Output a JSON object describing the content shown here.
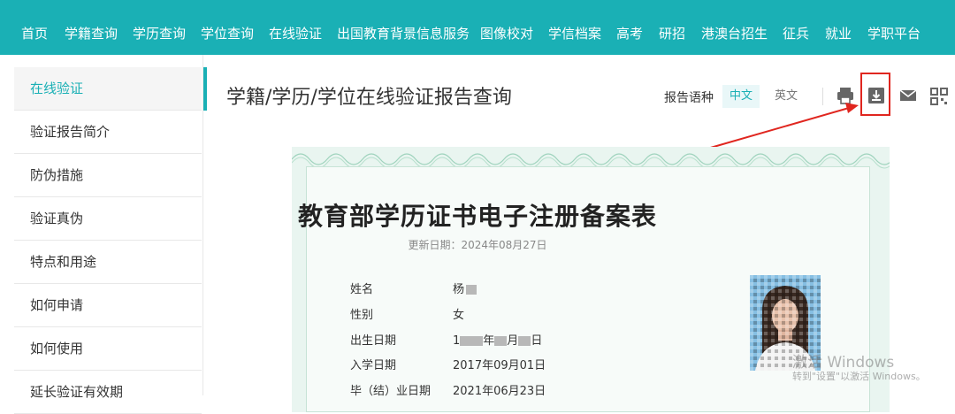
{
  "nav": {
    "items": [
      "首页",
      "学籍查询",
      "学历查询",
      "学位查询",
      "在线验证",
      "出国教育背景信息服务",
      "图像校对",
      "学信档案",
      "高考",
      "研招",
      "港澳台招生",
      "征兵",
      "就业",
      "学职平台"
    ]
  },
  "sidebar": {
    "items": [
      "在线验证",
      "验证报告简介",
      "防伪措施",
      "验证真伪",
      "特点和用途",
      "如何申请",
      "如何使用",
      "延长验证有效期"
    ]
  },
  "main": {
    "title": "学籍/学历/学位在线验证报告查询"
  },
  "report_lang": {
    "label": "报告语种",
    "zh": "中文",
    "en": "英文"
  },
  "toolbar": {
    "icons": [
      "printer-icon",
      "download-icon",
      "mail-icon",
      "qrcode-icon"
    ]
  },
  "certificate": {
    "title": "教育部学历证书电子注册备案表",
    "update_date": "更新日期：2024年08月27日",
    "fields": [
      {
        "label": "姓名",
        "value": "杨"
      },
      {
        "label": "性别",
        "value": "女"
      },
      {
        "label": "出生日期",
        "value_parts": [
          "1",
          "年",
          "月",
          "日"
        ]
      },
      {
        "label": "入学日期",
        "value": "2017年09月01日"
      },
      {
        "label": "毕（结）业日期",
        "value": "2021年06月23日"
      }
    ]
  },
  "watermark": {
    "title": "激活 Windows",
    "subtitle": "转到\"设置\"以激活 Windows。"
  },
  "colors": {
    "accent": "#1ab0b5",
    "annotation_red": "#e0261f"
  }
}
